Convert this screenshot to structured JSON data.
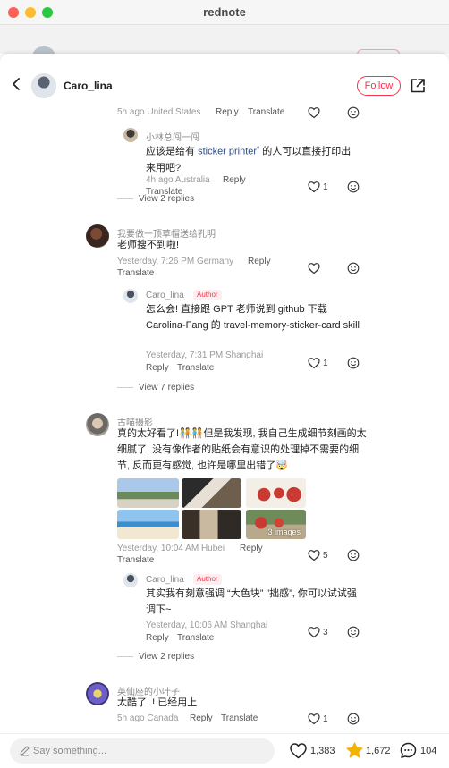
{
  "window": {
    "title": "rednote"
  },
  "header": {
    "username": "Caro_lina",
    "follow_label": "Follow"
  },
  "top_comment_meta": {
    "time_loc": "5h ago United States",
    "reply": "Reply",
    "translate": "Translate"
  },
  "threads": [
    {
      "reply": {
        "name": "小林总闯一闯",
        "text_before": "应该是给有",
        "link": "sticker printer",
        "link_mark": "ᵠ",
        "text_after": "的人可以直接打印出来用吧?",
        "time_loc": "4h ago Australia",
        "reply_label": "Reply",
        "translate_label": "Translate",
        "likes": "1"
      },
      "view_replies": "View 2 replies"
    },
    {
      "comment": {
        "name": "我要做一顶草帽送给孔明",
        "text": "老师搜不到啦!",
        "time_loc": "Yesterday, 7:26 PM Germany",
        "reply_label": "Reply",
        "translate_label": "Translate"
      },
      "reply": {
        "name": "Caro_lina",
        "author_tag": "Author",
        "text": "怎么会! 直接跟 GPT 老师说到 github 下载 Carolina-Fang 的 travel-memory-sticker-card skill",
        "time_loc": "Yesterday, 7:31 PM Shanghai",
        "reply_label": "Reply",
        "translate_label": "Translate",
        "likes": "1"
      },
      "view_replies": "View 7 replies"
    },
    {
      "comment": {
        "name": "古喵摄影",
        "text_before": "真的太好看了!",
        "emoji_pair": "🧑‍🤝‍🧑🧑‍🤝‍🧑",
        "text_after": "但是我发现, 我自己生成细节刻画的太细腻了, 没有像作者的贴纸会有意识的处理掉不需要的细节, 反而更有感觉, 也许是哪里出错了",
        "emoji_end": "🤯",
        "images_count_label": "3 images",
        "time_loc": "Yesterday, 10:04 AM Hubei",
        "reply_label": "Reply",
        "translate_label": "Translate",
        "likes": "5"
      },
      "reply": {
        "name": "Caro_lina",
        "author_tag": "Author",
        "text": "其实我有刻意强调 “大色块” ”拙感”, 你可以试试强调下~",
        "time_loc": "Yesterday, 10:06 AM Shanghai",
        "reply_label": "Reply",
        "translate_label": "Translate",
        "likes": "3"
      },
      "view_replies": "View 2 replies"
    },
    {
      "comment": {
        "name": "英仙座的小叶子",
        "text": "太酷了! ! 已经用上",
        "time_loc": "5h ago Canada",
        "reply_label": "Reply",
        "translate_label": "Translate",
        "likes": "1"
      }
    }
  ],
  "footer": {
    "placeholder": "Say something...",
    "likes": "1,383",
    "stars": "1,672",
    "comments": "104"
  },
  "colors": {
    "accent": "#ff2e4d",
    "star": "#f5b301",
    "link": "#2a4d8f"
  }
}
